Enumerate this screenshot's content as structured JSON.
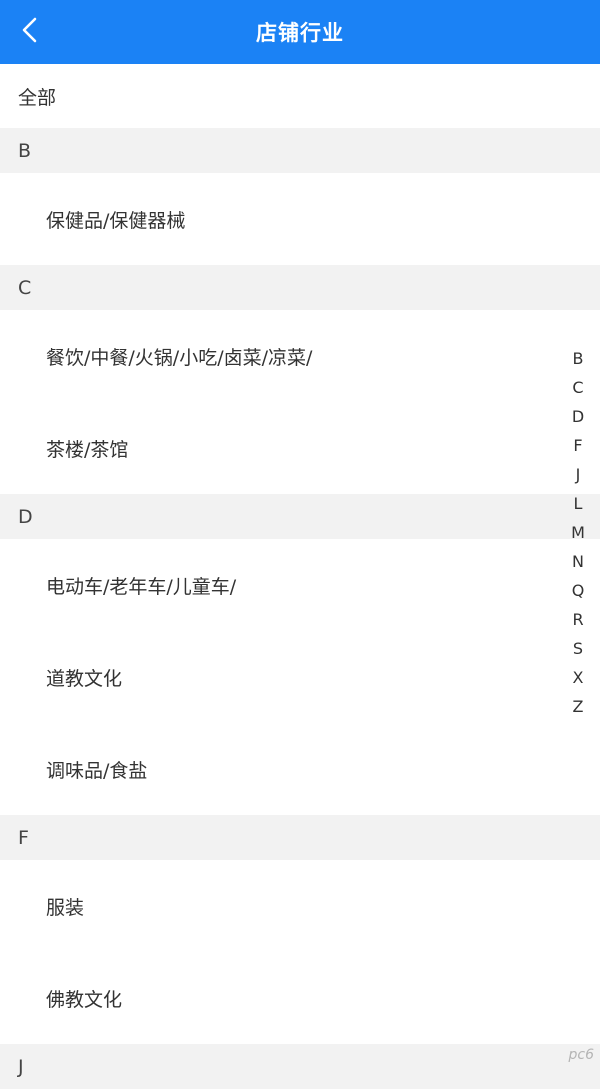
{
  "header": {
    "title": "店铺行业",
    "back_icon": "chevron-left-icon"
  },
  "all_label": "全部",
  "sections": [
    {
      "letter": "B",
      "items": [
        "保健品/保健器械"
      ]
    },
    {
      "letter": "C",
      "items": [
        "餐饮/中餐/火锅/小吃/卤菜/凉菜/",
        "茶楼/茶馆"
      ]
    },
    {
      "letter": "D",
      "items": [
        "电动车/老年车/儿童车/",
        "道教文化",
        "调味品/食盐"
      ]
    },
    {
      "letter": "F",
      "items": [
        "服装",
        "佛教文化"
      ]
    },
    {
      "letter": "J",
      "items": []
    }
  ],
  "index": [
    "B",
    "C",
    "D",
    "F",
    "J",
    "L",
    "M",
    "N",
    "Q",
    "R",
    "S",
    "X",
    "Z"
  ],
  "watermark": "pc6",
  "colors": {
    "accent": "#1b82f5",
    "section_bg": "#f2f2f2"
  }
}
